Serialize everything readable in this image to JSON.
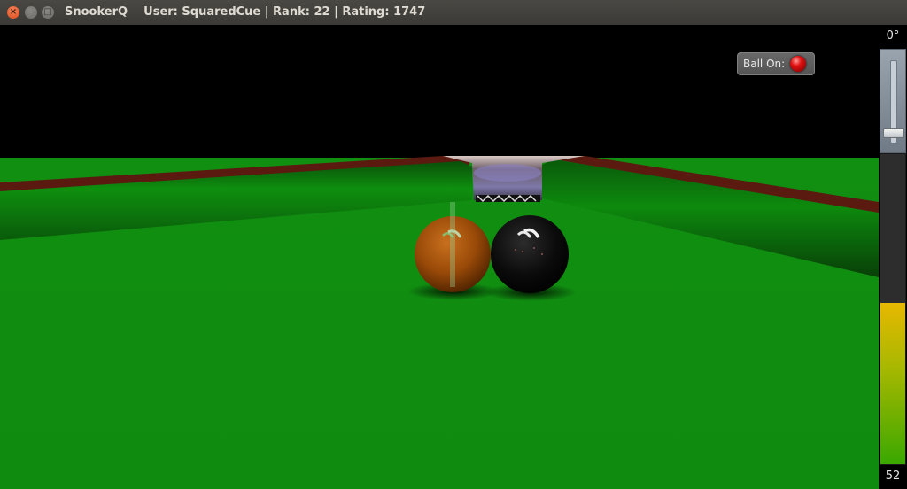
{
  "window": {
    "title": "SnookerQ    User: SquaredCue | Rank: 22 | Rating: 1747",
    "buttons": [
      "close",
      "minimize",
      "maximize"
    ]
  },
  "hud": {
    "ball_on_label": "Ball On:",
    "ball_on_color": "#e01010",
    "cue_angle_label": "0°",
    "cue_angle": 0,
    "power_label": "52",
    "power_fraction": 0.52
  },
  "scene": {
    "cloth_color": "#0e8a0e",
    "cushion_color": "#0b7a0b",
    "rail_color": "#5a1a10",
    "balls": [
      {
        "name": "brown",
        "color": "#a04d0a"
      },
      {
        "name": "black",
        "color": "#0b0b0b"
      }
    ]
  }
}
